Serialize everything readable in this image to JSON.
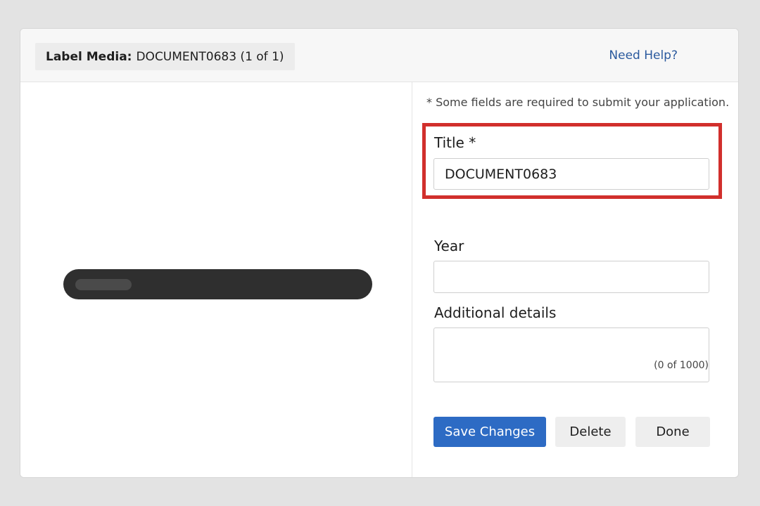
{
  "header": {
    "label": "Label Media:",
    "document_name": "DOCUMENT0683 (1 of 1)",
    "help_link": "Need Help?"
  },
  "form": {
    "required_note": "* Some fields are required to submit your application.",
    "title": {
      "label": "Title *",
      "value": "DOCUMENT0683"
    },
    "year": {
      "label": "Year",
      "value": ""
    },
    "details": {
      "label": "Additional details",
      "value": "",
      "counter": "(0 of 1000)"
    }
  },
  "actions": {
    "save": "Save Changes",
    "delete": "Delete",
    "done": "Done"
  },
  "colors": {
    "primary": "#2d6bc4",
    "highlight": "#d12f2c",
    "link": "#2b5a9e"
  }
}
